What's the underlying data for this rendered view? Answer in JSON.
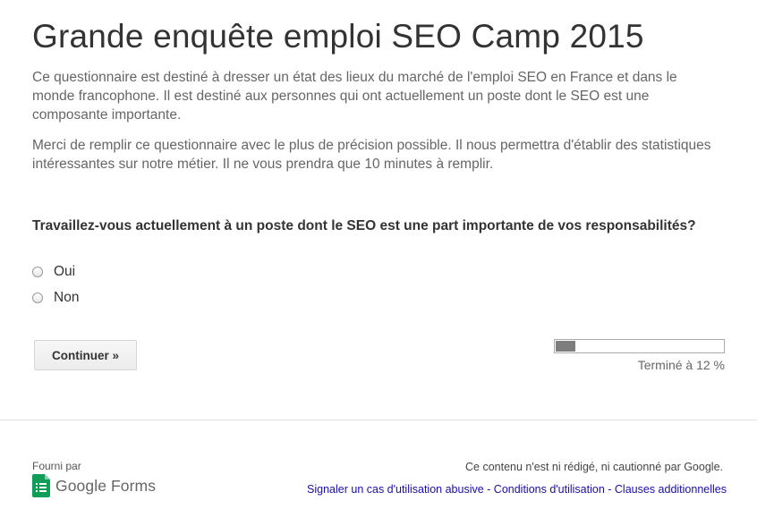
{
  "form": {
    "title": "Grande enquête emploi SEO Camp 2015",
    "description_1": "Ce questionnaire est destiné à dresser un état des lieux du marché de l'emploi SEO en France et dans le monde francophone. Il est destiné aux personnes qui ont actuellement un poste dont le SEO est une composante importante.",
    "description_2": "Merci de remplir ce questionnaire avec le plus de précision possible. Il nous permettra d'établir des statistiques intéressantes sur notre métier. Il ne vous prendra que 10 minutes à remplir."
  },
  "question": {
    "text": "Travaillez-vous actuellement à un poste dont le SEO est une part importante de vos responsabilités?",
    "options": [
      {
        "label": "Oui",
        "selected": false
      },
      {
        "label": "Non",
        "selected": false
      }
    ]
  },
  "navigation": {
    "continue_label": "Continuer »"
  },
  "progress": {
    "percent": 12,
    "label": "Terminé à 12 %",
    "fill_color": "#7d7d7d"
  },
  "footer": {
    "powered_by": "Fourni par",
    "logo_text": "Google Forms",
    "logo_icon": "google-forms-icon",
    "disclaimer": "Ce contenu n'est ni rédigé, ni cautionné par Google.",
    "links": [
      {
        "label": "Signaler un cas d'utilisation abusive"
      },
      {
        "label": "Conditions d'utilisation"
      },
      {
        "label": "Clauses additionnelles"
      }
    ],
    "link_separator": " - ",
    "link_color": "#1a0dab",
    "logo_green": "#0f9d58"
  }
}
